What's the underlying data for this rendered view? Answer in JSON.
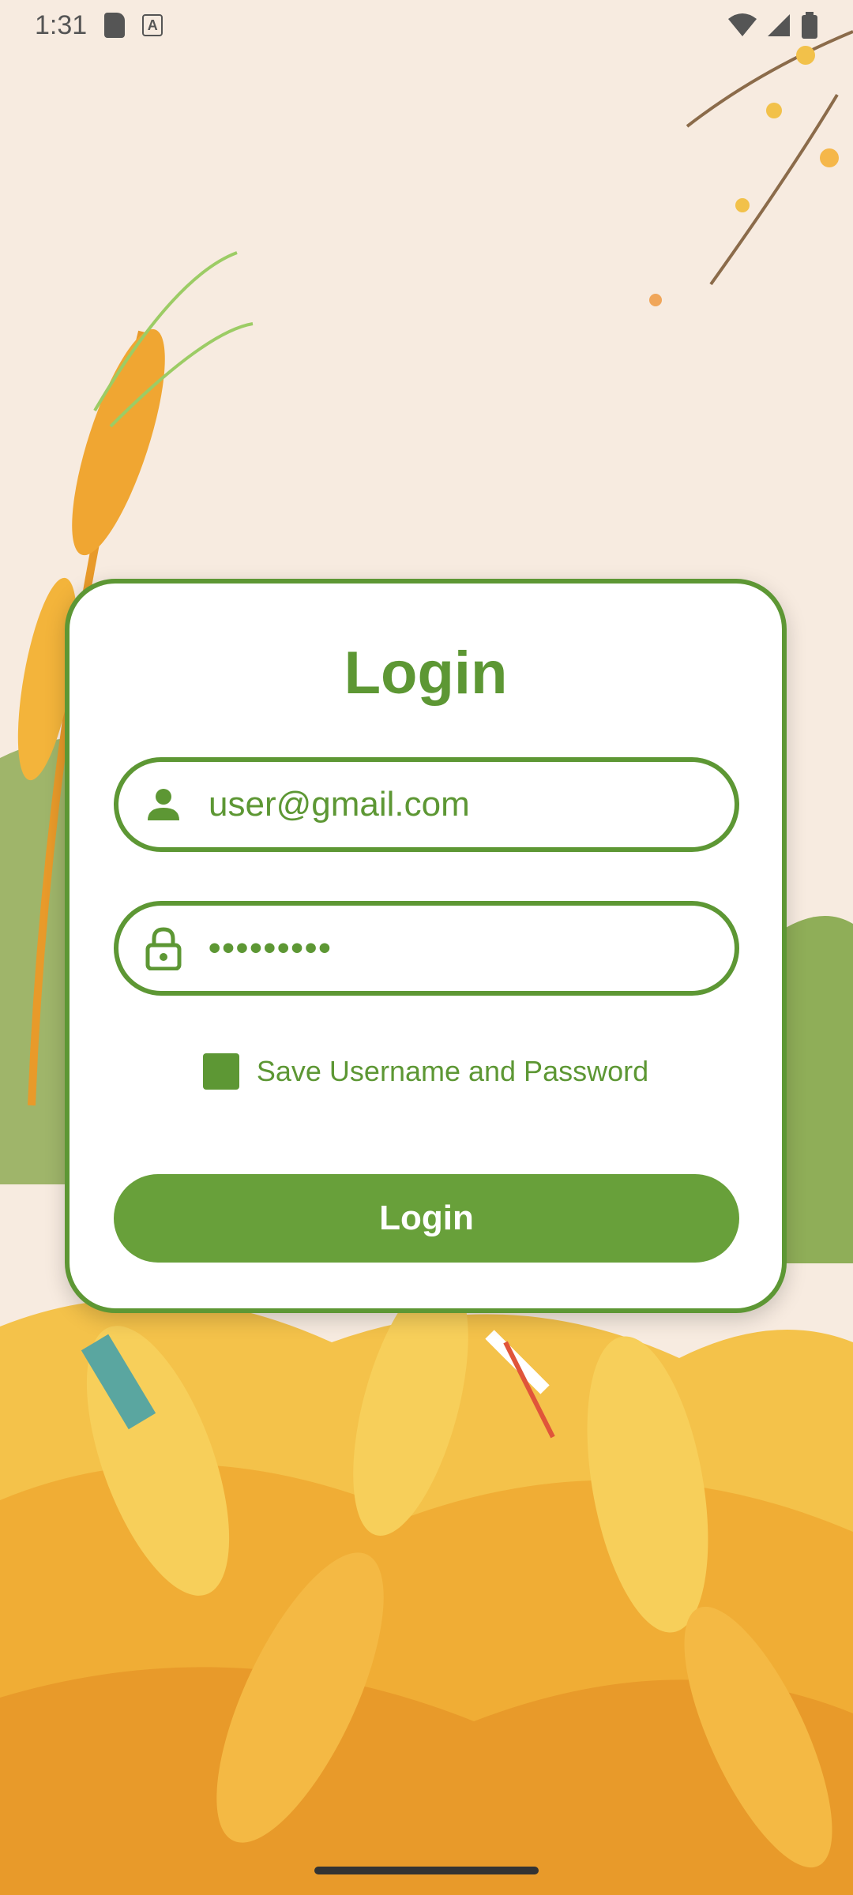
{
  "status_bar": {
    "time": "1:31"
  },
  "login": {
    "title": "Login",
    "email_value": "user@gmail.com",
    "password_masked": "•••••••••",
    "remember_label": "Save Username and Password",
    "remember_checked": true,
    "button_label": "Login"
  },
  "icons": [
    "user-icon",
    "lock-icon",
    "wifi-icon",
    "signal-icon",
    "battery-icon",
    "sd-card-icon",
    "a-notification-icon"
  ],
  "colors": {
    "accent": "#5d9734",
    "button": "#68a03a",
    "background": "#f7ebe0"
  }
}
